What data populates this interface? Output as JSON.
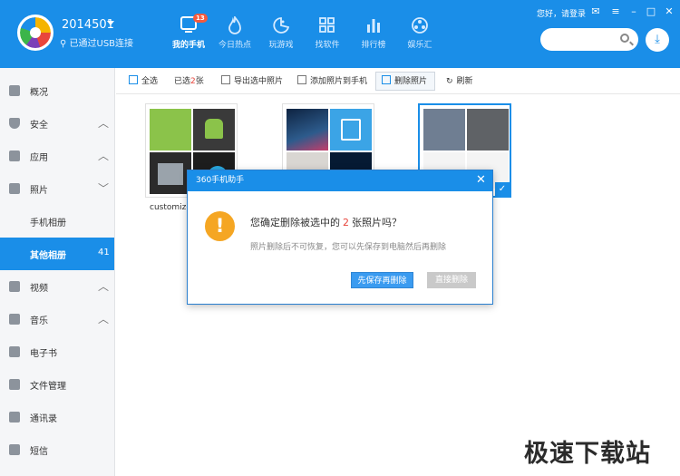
{
  "device": {
    "name": "2014501",
    "status": "已通过USB连接"
  },
  "nav": [
    {
      "label": "我的手机",
      "icon": "phone-icon",
      "badge": "13",
      "active": true
    },
    {
      "label": "今日热点",
      "icon": "flame-icon"
    },
    {
      "label": "玩游戏",
      "icon": "game-icon"
    },
    {
      "label": "找软件",
      "icon": "apps-grid-icon"
    },
    {
      "label": "排行榜",
      "icon": "bar-chart-icon"
    },
    {
      "label": "娱乐汇",
      "icon": "film-reel-icon"
    }
  ],
  "header": {
    "login": "您好，请登录"
  },
  "sidebar": {
    "items": [
      {
        "label": "概况",
        "icon": "home-icon"
      },
      {
        "label": "安全",
        "icon": "shield-icon"
      },
      {
        "label": "应用",
        "icon": "apps-icon"
      },
      {
        "label": "照片",
        "icon": "photo-icon"
      },
      {
        "label": "手机相册"
      },
      {
        "label": "其他相册",
        "count": "41"
      },
      {
        "label": "视频",
        "icon": "video-icon"
      },
      {
        "label": "音乐",
        "icon": "music-icon"
      },
      {
        "label": "电子书",
        "icon": "book-icon"
      },
      {
        "label": "文件管理",
        "icon": "folder-icon"
      },
      {
        "label": "通讯录",
        "icon": "contacts-icon"
      },
      {
        "label": "短信",
        "icon": "sms-icon"
      }
    ]
  },
  "toolbar": {
    "select_all": "全选",
    "selected_prefix": "已选",
    "selected_count": "2",
    "selected_suffix": "张",
    "export": "导出选中照片",
    "add": "添加照片到手机",
    "delete": "删除照片",
    "refresh": "刷新"
  },
  "album": {
    "label": "customize"
  },
  "dialog": {
    "title": "360手机助手",
    "message_prefix": "您确定删除被选中的",
    "message_count": "2",
    "message_suffix": "张照片吗？",
    "sub": "照片删除后不可恢复，您可以先保存到电脑然后再删除",
    "save_button": "先保存再删除",
    "delete_button": "直接删除"
  },
  "watermark": "极速下载站",
  "colors": {
    "accent": "#1a8ee8",
    "warning": "#f5a623",
    "danger": "#e8453c"
  }
}
